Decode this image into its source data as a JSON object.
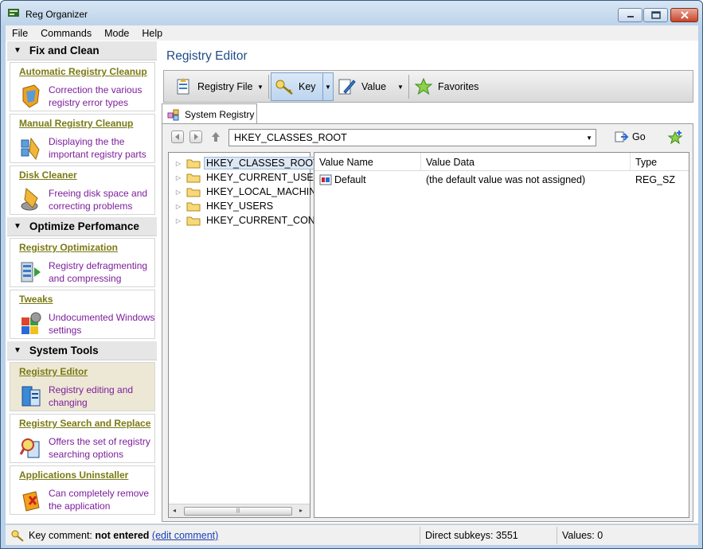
{
  "window": {
    "title": "Reg Organizer"
  },
  "menu": [
    "File",
    "Commands",
    "Mode",
    "Help"
  ],
  "sidebar": {
    "sections": [
      {
        "title": "Fix and Clean",
        "items": [
          {
            "title": "Automatic Registry Cleanup",
            "desc": "Correction the various registry error types",
            "icon": "broom-shield-icon"
          },
          {
            "title": "Manual Registry Cleanup",
            "desc": "Displaying the the important registry parts",
            "icon": "broom-cubes-icon"
          },
          {
            "title": "Disk Cleaner",
            "desc": "Freeing disk space and correcting problems",
            "icon": "broom-disk-icon"
          }
        ]
      },
      {
        "title": "Optimize Perfomance",
        "items": [
          {
            "title": "Registry Optimization",
            "desc": "Registry defragmenting and compressing",
            "icon": "defrag-icon"
          },
          {
            "title": "Tweaks",
            "desc": "Undocumented Windows settings",
            "icon": "tweaks-icon"
          }
        ]
      },
      {
        "title": "System Tools",
        "items": [
          {
            "title": "Registry Editor",
            "desc": "Registry editing and changing",
            "icon": "registry-editor-icon"
          },
          {
            "title": "Registry Search and Replace",
            "desc": "Offers the set of registry searching options",
            "icon": "search-registry-icon"
          },
          {
            "title": "Applications Uninstaller",
            "desc": "Can completely remove the application",
            "icon": "uninstaller-icon"
          }
        ]
      }
    ]
  },
  "main": {
    "title": "Registry Editor",
    "toolbar": {
      "registry_file": "Registry File",
      "key": "Key",
      "value": "Value",
      "favorites": "Favorites"
    },
    "tab": "System Registry",
    "path": "HKEY_CLASSES_ROOT",
    "go": "Go",
    "tree": [
      "HKEY_CLASSES_ROOT",
      "HKEY_CURRENT_USER",
      "HKEY_LOCAL_MACHINE",
      "HKEY_USERS",
      "HKEY_CURRENT_CONFIG"
    ],
    "values": {
      "columns": [
        "Value Name",
        "Value Data",
        "Type"
      ],
      "rows": [
        {
          "name": "Default",
          "data": "(the default value was not assigned)",
          "type": "REG_SZ"
        }
      ]
    }
  },
  "status": {
    "key_comment_label": "Key comment:",
    "key_comment_value": "not entered",
    "edit_link": "(edit comment)",
    "subkeys": "Direct subkeys: 3551",
    "values": "Values: 0"
  },
  "colors": {
    "task_title": "#7a7a14",
    "task_desc": "#7d1e9c",
    "page_title": "#1f4d86",
    "active_task": "#ede8d5"
  }
}
